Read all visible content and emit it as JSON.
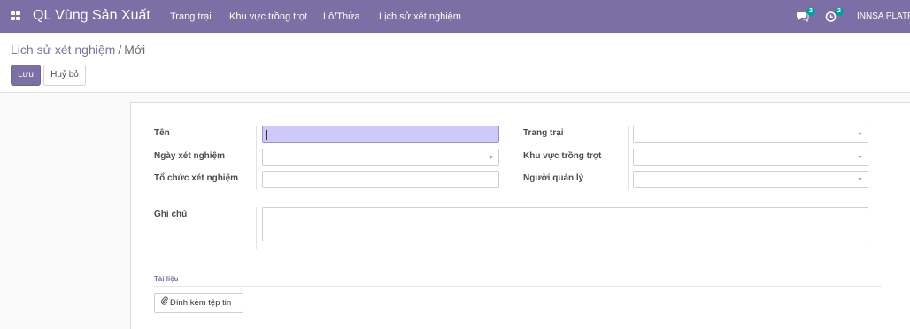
{
  "navbar": {
    "app_title": "QL Vùng Sản Xuất",
    "menu": [
      "Trang trại",
      "Khu vực trồng trọt",
      "Lô/Thửa",
      "Lịch sử xét nghiệm"
    ],
    "messages_count": "2",
    "activities_count": "2",
    "company": "INNSA PLATF"
  },
  "breadcrumb": {
    "parent": "Lịch sử xét nghiệm",
    "separator": "/",
    "current": "Mới"
  },
  "buttons": {
    "save": "Lưu",
    "discard": "Huỷ bỏ"
  },
  "form": {
    "name_label": "Tên",
    "name_value": "",
    "test_date_label": "Ngày xét nghiệm",
    "test_date_value": "",
    "test_org_label": "Tổ chức xét nghiệm",
    "test_org_value": "",
    "farm_label": "Trang trại",
    "farm_value": "",
    "growing_area_label": "Khu vực trồng trọt",
    "growing_area_value": "",
    "manager_label": "Người quản lý",
    "manager_value": "",
    "note_label": "Ghi chú",
    "note_value": ""
  },
  "documents": {
    "section_title": "Tài liệu",
    "attach_label": "Đính kèm tệp tin"
  },
  "colors": {
    "brand": "#7c6fa5",
    "focus_field": "#cdc9f9",
    "badge": "#00a09d"
  }
}
